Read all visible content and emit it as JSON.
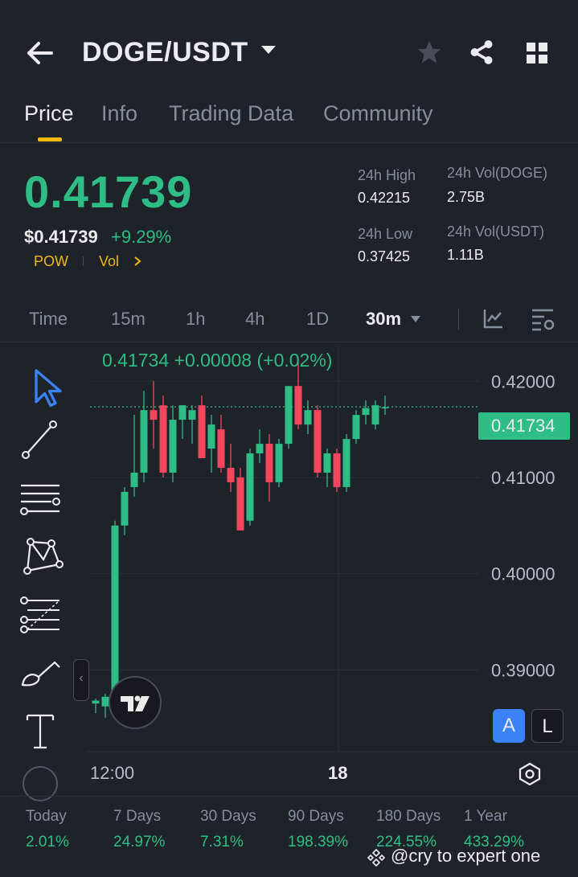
{
  "header": {
    "pair": "DOGE/USDT"
  },
  "tabs": [
    "Price",
    "Info",
    "Trading Data",
    "Community"
  ],
  "ticker": {
    "last_price": "0.41739",
    "usd_price": "$0.41739",
    "change_pct": "+9.29%",
    "tags": [
      "POW",
      "Vol"
    ],
    "stats": {
      "high_label": "24h High",
      "high": "0.42215",
      "low_label": "24h Low",
      "low": "0.37425",
      "vol_base_label": "24h Vol(DOGE)",
      "vol_base": "2.75B",
      "vol_quote_label": "24h Vol(USDT)",
      "vol_quote": "1.11B"
    }
  },
  "intervals": [
    "Time",
    "15m",
    "1h",
    "4h",
    "1D",
    "30m"
  ],
  "chart_header": "0.41734  +0.00008 (+0.02%)",
  "current_price_tag": "0.41734",
  "axis_buttons": [
    "A",
    "L"
  ],
  "chart_data": {
    "type": "candlestick",
    "ylim": [
      0.3815,
      0.4237
    ],
    "y_ticks": [
      "0.42000",
      "0.41000",
      "0.40000",
      "0.39000"
    ],
    "x_ticks": [
      "12:00",
      "18"
    ],
    "current_price": 0.41734,
    "candles": [
      {
        "o": 0.3865,
        "h": 0.387,
        "l": 0.3855,
        "c": 0.3868
      },
      {
        "o": 0.3862,
        "h": 0.3875,
        "l": 0.385,
        "c": 0.3872
      },
      {
        "o": 0.387,
        "h": 0.4055,
        "l": 0.3865,
        "c": 0.405
      },
      {
        "o": 0.405,
        "h": 0.409,
        "l": 0.404,
        "c": 0.4085
      },
      {
        "o": 0.409,
        "h": 0.4165,
        "l": 0.408,
        "c": 0.4105
      },
      {
        "o": 0.4105,
        "h": 0.419,
        "l": 0.4095,
        "c": 0.417
      },
      {
        "o": 0.417,
        "h": 0.42,
        "l": 0.413,
        "c": 0.416
      },
      {
        "o": 0.4175,
        "h": 0.4185,
        "l": 0.41,
        "c": 0.4105
      },
      {
        "o": 0.4105,
        "h": 0.4175,
        "l": 0.4095,
        "c": 0.416
      },
      {
        "o": 0.416,
        "h": 0.4175,
        "l": 0.414,
        "c": 0.4175
      },
      {
        "o": 0.416,
        "h": 0.4175,
        "l": 0.4135,
        "c": 0.417
      },
      {
        "o": 0.4175,
        "h": 0.4185,
        "l": 0.412,
        "c": 0.412
      },
      {
        "o": 0.413,
        "h": 0.4165,
        "l": 0.4105,
        "c": 0.4155
      },
      {
        "o": 0.415,
        "h": 0.4165,
        "l": 0.4105,
        "c": 0.411
      },
      {
        "o": 0.411,
        "h": 0.4135,
        "l": 0.4085,
        "c": 0.4095
      },
      {
        "o": 0.41,
        "h": 0.411,
        "l": 0.4045,
        "c": 0.4045
      },
      {
        "o": 0.4055,
        "h": 0.413,
        "l": 0.405,
        "c": 0.4125
      },
      {
        "o": 0.4125,
        "h": 0.415,
        "l": 0.4115,
        "c": 0.4135
      },
      {
        "o": 0.4135,
        "h": 0.4145,
        "l": 0.4075,
        "c": 0.4095
      },
      {
        "o": 0.4095,
        "h": 0.414,
        "l": 0.409,
        "c": 0.4135
      },
      {
        "o": 0.4135,
        "h": 0.4195,
        "l": 0.413,
        "c": 0.4195
      },
      {
        "o": 0.4195,
        "h": 0.4225,
        "l": 0.415,
        "c": 0.4155
      },
      {
        "o": 0.4155,
        "h": 0.418,
        "l": 0.4145,
        "c": 0.417
      },
      {
        "o": 0.417,
        "h": 0.4175,
        "l": 0.41,
        "c": 0.4105
      },
      {
        "o": 0.4105,
        "h": 0.413,
        "l": 0.409,
        "c": 0.4125
      },
      {
        "o": 0.4125,
        "h": 0.413,
        "l": 0.4085,
        "c": 0.409
      },
      {
        "o": 0.409,
        "h": 0.4145,
        "l": 0.4085,
        "c": 0.414
      },
      {
        "o": 0.414,
        "h": 0.417,
        "l": 0.4135,
        "c": 0.4165
      },
      {
        "o": 0.4165,
        "h": 0.418,
        "l": 0.4155,
        "c": 0.4172
      },
      {
        "o": 0.4155,
        "h": 0.418,
        "l": 0.415,
        "c": 0.4175
      },
      {
        "o": 0.4172,
        "h": 0.4185,
        "l": 0.4165,
        "c": 0.4173
      }
    ],
    "up_color": "#2ebd85",
    "down_color": "#f6465d"
  },
  "performance": [
    {
      "label": "Today",
      "value": "2.01%"
    },
    {
      "label": "7 Days",
      "value": "24.97%"
    },
    {
      "label": "30 Days",
      "value": "7.31%"
    },
    {
      "label": "90 Days",
      "value": "198.39%"
    },
    {
      "label": "180 Days",
      "value": "224.55%"
    },
    {
      "label": "1 Year",
      "value": "433.29%"
    }
  ],
  "watermark": "@cry  to expert one",
  "colors": {
    "accent": "#f0b90b",
    "up": "#2ebd85",
    "down": "#f6465d",
    "bg": "#1e2329"
  }
}
